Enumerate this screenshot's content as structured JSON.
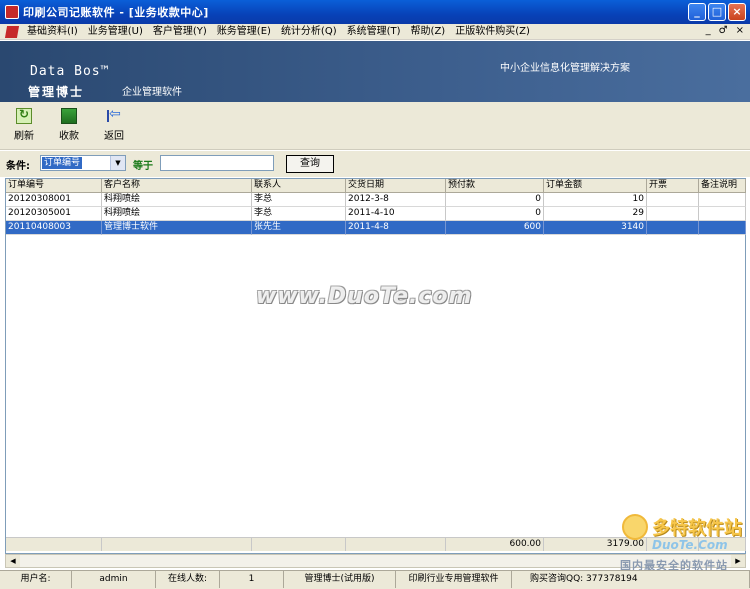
{
  "window": {
    "title": "印刷公司记账软件 - [业务收款中心]",
    "minimize": "_",
    "maximize": "□",
    "close": "×"
  },
  "menu": {
    "items": [
      "基础资料(I)",
      "业务管理(U)",
      "客户管理(Y)",
      "账务管理(E)",
      "统计分析(Q)",
      "系统管理(T)",
      "帮助(Z)",
      "正版软件购买(Z)"
    ],
    "mdi": [
      "_",
      "♂",
      "×"
    ]
  },
  "banner": {
    "brand": "Data Bos™",
    "product": "管理博士",
    "subtitle": "企业管理软件",
    "slogan": "中小企业信息化管理解决方案"
  },
  "toolbar": {
    "refresh": "刷新",
    "receipt": "收款",
    "back": "返回"
  },
  "filter": {
    "label": "条件:",
    "field": "订单编号",
    "operator": "等于",
    "value": "",
    "query": "查询"
  },
  "grid": {
    "columns": [
      "订单编号",
      "客户名称",
      "联系人",
      "交货日期",
      "预付款",
      "订单金额",
      "开票",
      "备注说明"
    ],
    "rows": [
      {
        "order_no": "20120308001",
        "customer": "科翔喷绘",
        "contact": "李总",
        "date": "2012-3-8",
        "prepay": "0",
        "amount": "10",
        "invoice": "",
        "note": ""
      },
      {
        "order_no": "20120305001",
        "customer": "科翔喷绘",
        "contact": "李总",
        "date": "2011-4-10",
        "prepay": "0",
        "amount": "29",
        "invoice": "",
        "note": ""
      },
      {
        "order_no": "20110408003",
        "customer": "管理博士软件",
        "contact": "张先生",
        "date": "2011-4-8",
        "prepay": "600",
        "amount": "3140",
        "invoice": "",
        "note": ""
      }
    ],
    "totals": {
      "prepay": "600.00",
      "amount": "3179.00"
    }
  },
  "status": {
    "user_label": "用户名:",
    "user": "admin",
    "online_label": "在线人数:",
    "online": "1",
    "edition": "管理博士(试用版)",
    "industry": "印刷行业专用管理软件",
    "contact": "购买咨询QQ: 377378194"
  },
  "watermark": {
    "url": "www.DuoTe.com",
    "site": "多特软件站",
    "site_domain": "DuoTe.Com",
    "site_slogan": "国内最安全的软件站"
  },
  "colors": {
    "titlebar": "#0842b8",
    "banner": "#3d5f8e",
    "selection": "#316ac5",
    "chrome": "#ece9d8"
  }
}
